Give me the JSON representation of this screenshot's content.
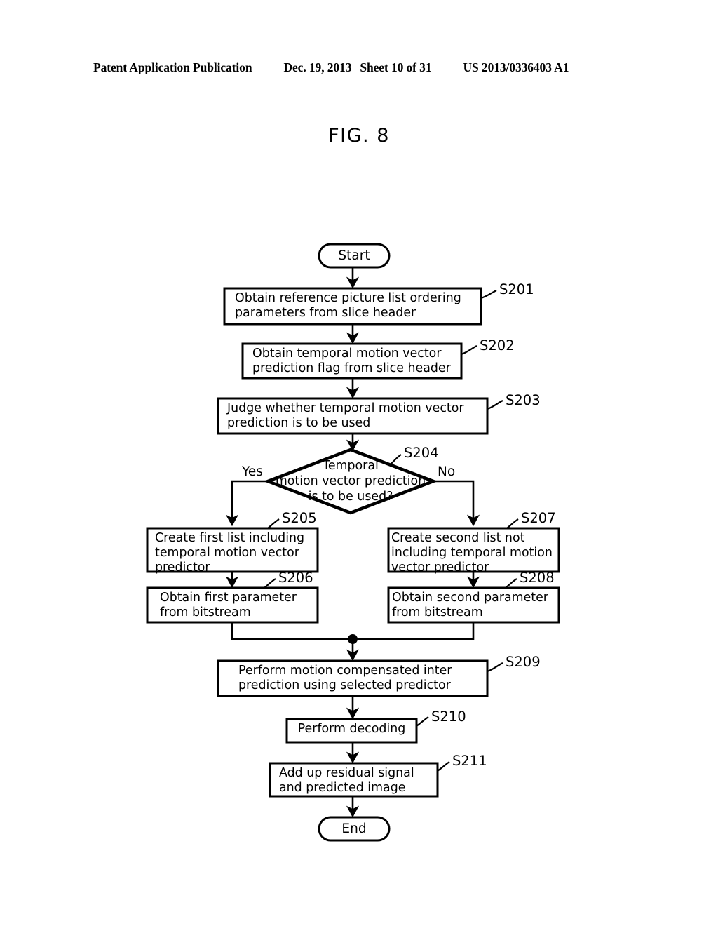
{
  "header": {
    "publication": "Patent Application Publication",
    "date": "Dec. 19, 2013",
    "sheet": "Sheet 10 of 31",
    "number": "US 2013/0336403 A1"
  },
  "figure": {
    "title": "FIG. 8"
  },
  "flowchart": {
    "terminators": {
      "start": "Start",
      "end": "End"
    },
    "branch_labels": {
      "yes": "Yes",
      "no": "No"
    },
    "nodes": [
      {
        "id": "S201",
        "label": "S201",
        "text": "Obtain reference picture list ordering\nparameters from slice header",
        "shape": "process"
      },
      {
        "id": "S202",
        "label": "S202",
        "text": "Obtain temporal motion vector\nprediction flag from slice header",
        "shape": "process"
      },
      {
        "id": "S203",
        "label": "S203",
        "text": "Judge whether temporal motion vector\nprediction is to be used",
        "shape": "process"
      },
      {
        "id": "S204",
        "label": "S204",
        "text": "Temporal\nmotion vector prediction\nis to be used?",
        "shape": "decision"
      },
      {
        "id": "S205",
        "label": "S205",
        "text": "Create first list including\ntemporal motion vector\npredictor",
        "shape": "process"
      },
      {
        "id": "S206",
        "label": "S206",
        "text": "Obtain first parameter\nfrom bitstream",
        "shape": "process"
      },
      {
        "id": "S207",
        "label": "S207",
        "text": "Create second list not\nincluding temporal motion\nvector predictor",
        "shape": "process"
      },
      {
        "id": "S208",
        "label": "S208",
        "text": "Obtain second parameter\nfrom bitstream",
        "shape": "process"
      },
      {
        "id": "S209",
        "label": "S209",
        "text": "Perform motion compensated inter\nprediction using selected predictor",
        "shape": "process"
      },
      {
        "id": "S210",
        "label": "S210",
        "text": "Perform decoding",
        "shape": "process"
      },
      {
        "id": "S211",
        "label": "S211",
        "text": "Add up residual signal\nand predicted image",
        "shape": "process"
      }
    ],
    "colors": {
      "stroke": "#000000",
      "fill": "#ffffff",
      "text": "#000000"
    }
  }
}
